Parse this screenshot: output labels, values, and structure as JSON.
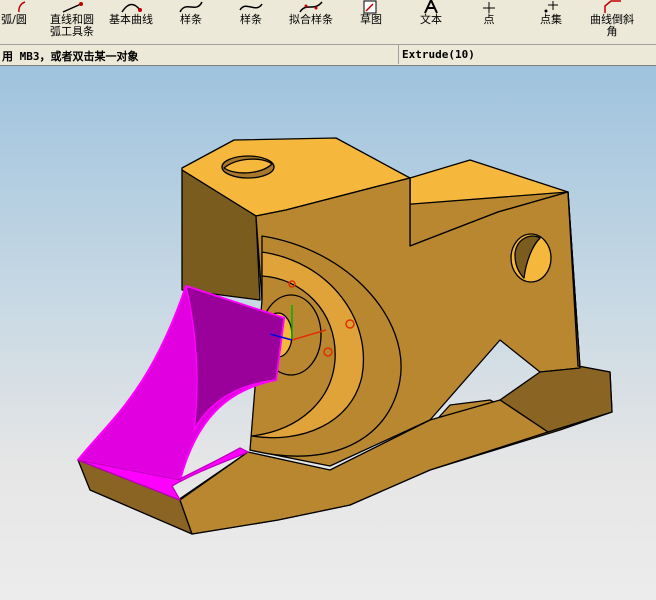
{
  "toolbar": {
    "items": [
      {
        "label": "弧/圆",
        "icon": "arc-circle-icon"
      },
      {
        "label": "直线和圆弧工具条",
        "icon": "line-arc-toolbar-icon"
      },
      {
        "label": "基本曲线",
        "icon": "basic-curve-icon"
      },
      {
        "label": "样条",
        "icon": "spline-icon"
      },
      {
        "label": "样条",
        "icon": "spline-icon"
      },
      {
        "label": "拟合样条",
        "icon": "fit-spline-icon"
      },
      {
        "label": "草图",
        "icon": "sketch-icon"
      },
      {
        "label": "文本",
        "icon": "text-icon"
      },
      {
        "label": "点",
        "icon": "point-icon"
      },
      {
        "label": "点集",
        "icon": "point-set-icon"
      },
      {
        "label": "曲线倒斜角",
        "icon": "curve-chamfer-icon"
      }
    ]
  },
  "status": {
    "prompt": "用 MB3，或者双击某一对象",
    "operation": "Extrude(10)"
  },
  "colors": {
    "model": "#f5b83d",
    "highlight": "#ff00ff",
    "edge": "#000000"
  }
}
